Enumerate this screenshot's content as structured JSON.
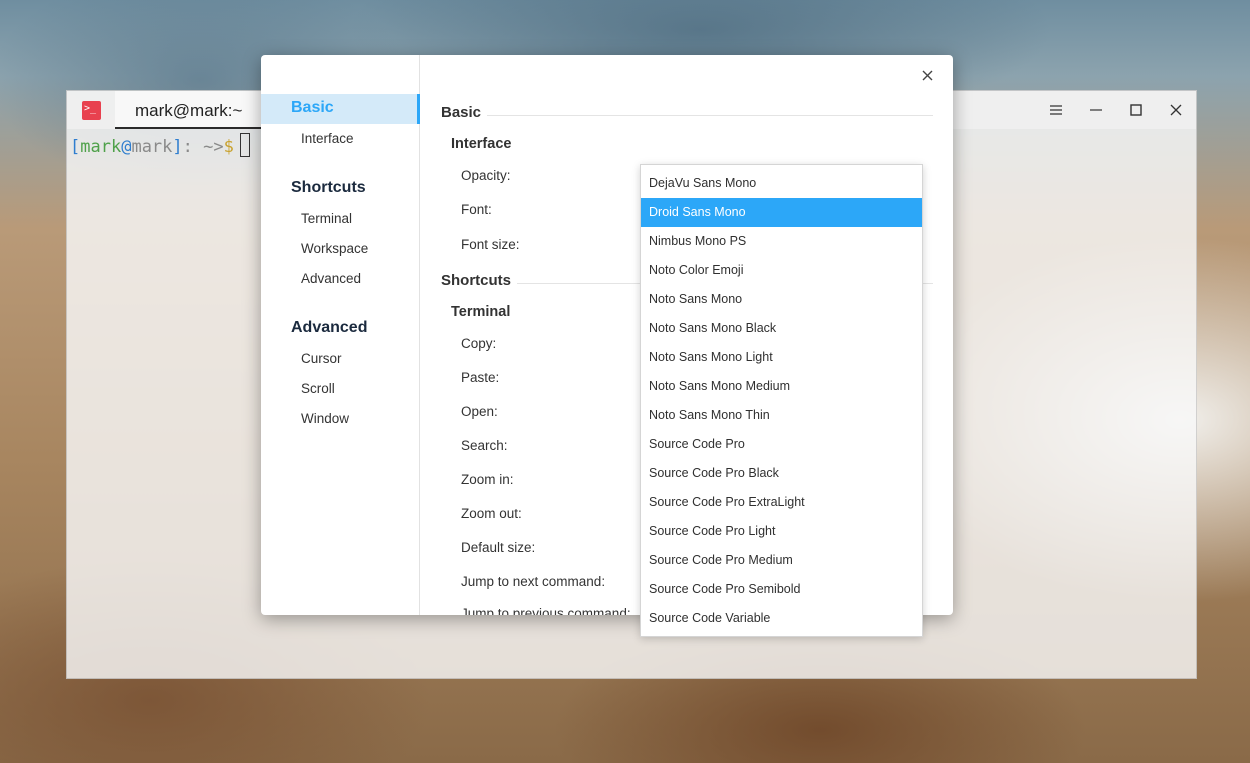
{
  "terminal": {
    "tab_title": "mark@mark:~",
    "prompt": {
      "open_bracket": "[",
      "user": "mark",
      "at": "@",
      "host": "mark",
      "close_bracket": "]",
      "path": ": ~>",
      "dollar": "$"
    },
    "app_icon_glyph": ">_",
    "icons": [
      "terminal-app-icon",
      "menu-icon",
      "minimize-icon",
      "maximize-icon",
      "close-icon"
    ]
  },
  "settings": {
    "nav": {
      "groups": [
        {
          "title": "Basic",
          "items": [
            "Interface"
          ]
        },
        {
          "title": "Shortcuts",
          "items": [
            "Terminal",
            "Workspace",
            "Advanced"
          ]
        },
        {
          "title": "Advanced",
          "items": [
            "Cursor",
            "Scroll",
            "Window"
          ]
        }
      ]
    },
    "content": {
      "basic_title": "Basic",
      "interface_title": "Interface",
      "opacity_label": "Opacity:",
      "font_label": "Font:",
      "font_size_label": "Font size:",
      "shortcuts_title": "Shortcuts",
      "terminal_title": "Terminal",
      "shortcut_labels": [
        "Copy:",
        "Paste:",
        "Open:",
        "Search:",
        "Zoom in:",
        "Zoom out:",
        "Default size:",
        "Jump to next command:",
        "Jump to previous command:"
      ]
    },
    "font_dropdown": {
      "selected": "Droid Sans Mono",
      "options": [
        "DejaVu Sans Mono",
        "Droid Sans Mono",
        "Nimbus Mono PS",
        "Noto Color Emoji",
        "Noto Sans Mono",
        "Noto Sans Mono Black",
        "Noto Sans Mono Light",
        "Noto Sans Mono Medium",
        "Noto Sans Mono Thin",
        "Source Code Pro",
        "Source Code Pro Black",
        "Source Code Pro ExtraLight",
        "Source Code Pro Light",
        "Source Code Pro Medium",
        "Source Code Pro Semibold",
        "Source Code Variable"
      ]
    }
  },
  "colors": {
    "accent": "#2ca7f8",
    "accent_bg": "#d4eaf9",
    "terminal_icon": "#e8414f"
  }
}
